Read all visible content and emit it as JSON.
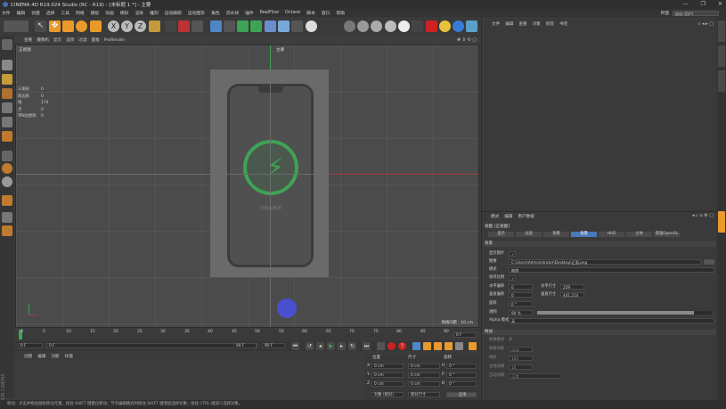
{
  "window": {
    "title": "CINEMA 4D R19.024 Studio (RC - R19) - [未标题 1 *] - 主要",
    "controls": [
      "—",
      "❐",
      "✕"
    ]
  },
  "menubar": {
    "items": [
      "文件",
      "编辑",
      "创建",
      "选择",
      "工具",
      "网格",
      "捕捉",
      "动画",
      "模拟",
      "渲染",
      "雕刻",
      "运动跟踪",
      "运动图形",
      "角色",
      "流水线",
      "插件",
      "RealFlow",
      "Octane",
      "脚本",
      "窗口",
      "帮助"
    ],
    "layout_label": "界面",
    "layout_value": "启动 (用户)"
  },
  "viewport_menu": [
    "查看",
    "摄像机",
    "显示",
    "选项",
    "过滤",
    "面板",
    "ProRender"
  ],
  "viewport": {
    "label": "正视图",
    "camera": "主要",
    "grid_info": "网格间距 : 10 cm",
    "phone_text": "切换备用源"
  },
  "stats": [
    {
      "k": "三角形",
      "v": "0"
    },
    {
      "k": "四边形",
      "v": "0"
    },
    {
      "k": "线",
      "v": "174"
    },
    {
      "k": "点",
      "v": "0"
    },
    {
      "k": "带N边图形",
      "v": "0"
    }
  ],
  "timeline": {
    "ticks": [
      "0",
      "5",
      "10",
      "15",
      "20",
      "25",
      "30",
      "35",
      "40",
      "45",
      "50",
      "55",
      "60",
      "65",
      "70",
      "75",
      "80",
      "85",
      "90"
    ],
    "end_field": "0 F",
    "start_field": "0 F",
    "current_field": "0 F",
    "min_field": "90 F",
    "max_field": "90 F"
  },
  "material_tabs": [
    "创建",
    "编辑",
    "功能",
    "纹理"
  ],
  "coords": {
    "headers": [
      "位置",
      "尺寸",
      "旋转"
    ],
    "rows": [
      {
        "axis": "X",
        "pos": "0 cm",
        "size": "0 cm",
        "rlabel": "H",
        "rot": "0 °"
      },
      {
        "axis": "Y",
        "pos": "0 cm",
        "size": "0 cm",
        "rlabel": "P",
        "rot": "0 °"
      },
      {
        "axis": "Z",
        "pos": "0 cm",
        "size": "0 cm",
        "rlabel": "B",
        "rot": "0 °"
      }
    ],
    "mode": "对象 (相对)",
    "size_mode": "绝对尺寸",
    "apply": "应用"
  },
  "statusbar": "移动：点击并拖动鼠标移动元素。按住 SHIFT 键量化移动；节点编辑模式时按住 SHIFT 键增加选择对象；按住 CTRL 键减少选择对象。",
  "maxon": "MAXON CINEMA 4D",
  "object_manager": {
    "menu": [
      "文件",
      "编辑",
      "查看",
      "对象",
      "标签",
      "书签"
    ]
  },
  "attributes": {
    "menu": [
      "模式",
      "编辑",
      "用户数据"
    ],
    "title": "视图 [正视图]",
    "tabs": [
      "显示",
      "过滤",
      "查看",
      "背景",
      "HUD",
      "立体",
      "增强OpenGL"
    ],
    "active_tab": "背景",
    "section": "背景",
    "props": [
      {
        "k": "显示图片",
        "v": "✓"
      },
      {
        "k": "图像",
        "v": "C:\\Users\\Administrator\\Desktop\\正面.png"
      },
      {
        "k": "模式",
        "v": "缩放"
      },
      {
        "k": "保持比例",
        "v": "✓"
      },
      {
        "k": "水平偏移",
        "v": "0"
      },
      {
        "k": "水平尺寸",
        "v": "259"
      },
      {
        "k": "垂直偏移",
        "v": "0"
      },
      {
        "k": "垂直尺寸",
        "v": "441.214"
      },
      {
        "k": "旋转",
        "v": "0 °"
      },
      {
        "k": "透明",
        "v": "90 %"
      },
      {
        "k": "Alpha 模式",
        "v": "无"
      }
    ],
    "transparency": 0.9,
    "section2": "附加",
    "props2": [
      {
        "k": "网格模式",
        "v": "开"
      },
      {
        "k": "网格间距",
        "v": "自动"
      },
      {
        "k": "线条",
        "v": "100"
      },
      {
        "k": "主线间隔",
        "v": "10"
      },
      {
        "k": "自动间隔",
        "v": "正常"
      }
    ]
  }
}
